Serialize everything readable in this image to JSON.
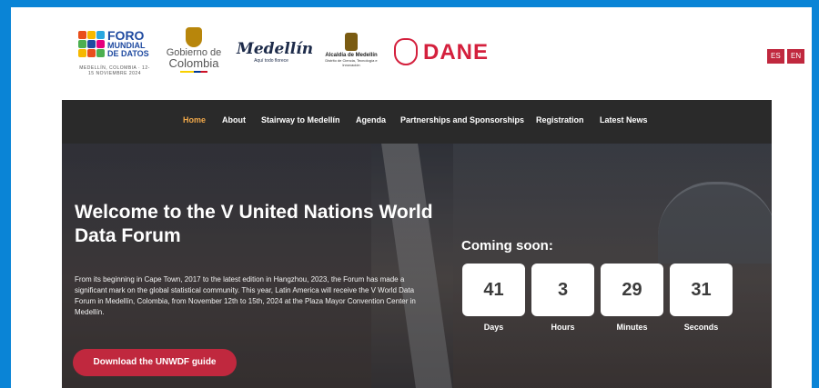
{
  "logos": {
    "foro": {
      "line1": "FORO",
      "line2": "MUNDIAL",
      "line3": "DE DATOS",
      "sub": "MEDELLÍN, COLOMBIA · 12-15 NOVIEMBRE 2024"
    },
    "gobierno": {
      "line1": "Gobierno de",
      "line2": "Colombia"
    },
    "medellin": {
      "title": "Medellín",
      "sub": "Aquí todo florece"
    },
    "alcaldia": {
      "title": "Alcaldía de Medellín",
      "sub": "Distrito de Ciencia, Tecnología e Innovación"
    },
    "dane": {
      "title": "DANE"
    }
  },
  "language": {
    "es": "ES",
    "en": "EN"
  },
  "nav": [
    "Home",
    "About",
    "Stairway to Medellín",
    "Agenda",
    "Partnerships and Sponsorships",
    "Registration",
    "Latest News"
  ],
  "hero": {
    "title": "Welcome to the V United Nations World Data Forum",
    "text": "From its beginning in Cape Town, 2017 to the latest edition in Hangzhou, 2023, the Forum has made a significant mark on the global statistical community. This year, Latin America will receive the V World Data Forum in Medellín, Colombia, from November 12th to 15th, 2024 at the Plaza Mayor Convention Center in Medellín.",
    "cta": "Download the UNWDF guide"
  },
  "countdown": {
    "title": "Coming soon:",
    "units": [
      {
        "value": "41",
        "label": "Days"
      },
      {
        "value": "3",
        "label": "Hours"
      },
      {
        "value": "29",
        "label": "Minutes"
      },
      {
        "value": "31",
        "label": "Seconds"
      }
    ]
  },
  "colors": {
    "brand_red": "#c0283e",
    "frame_blue": "#0a84d6",
    "nav_bg": "#2a2a2a",
    "nav_active": "#f0a84a"
  }
}
